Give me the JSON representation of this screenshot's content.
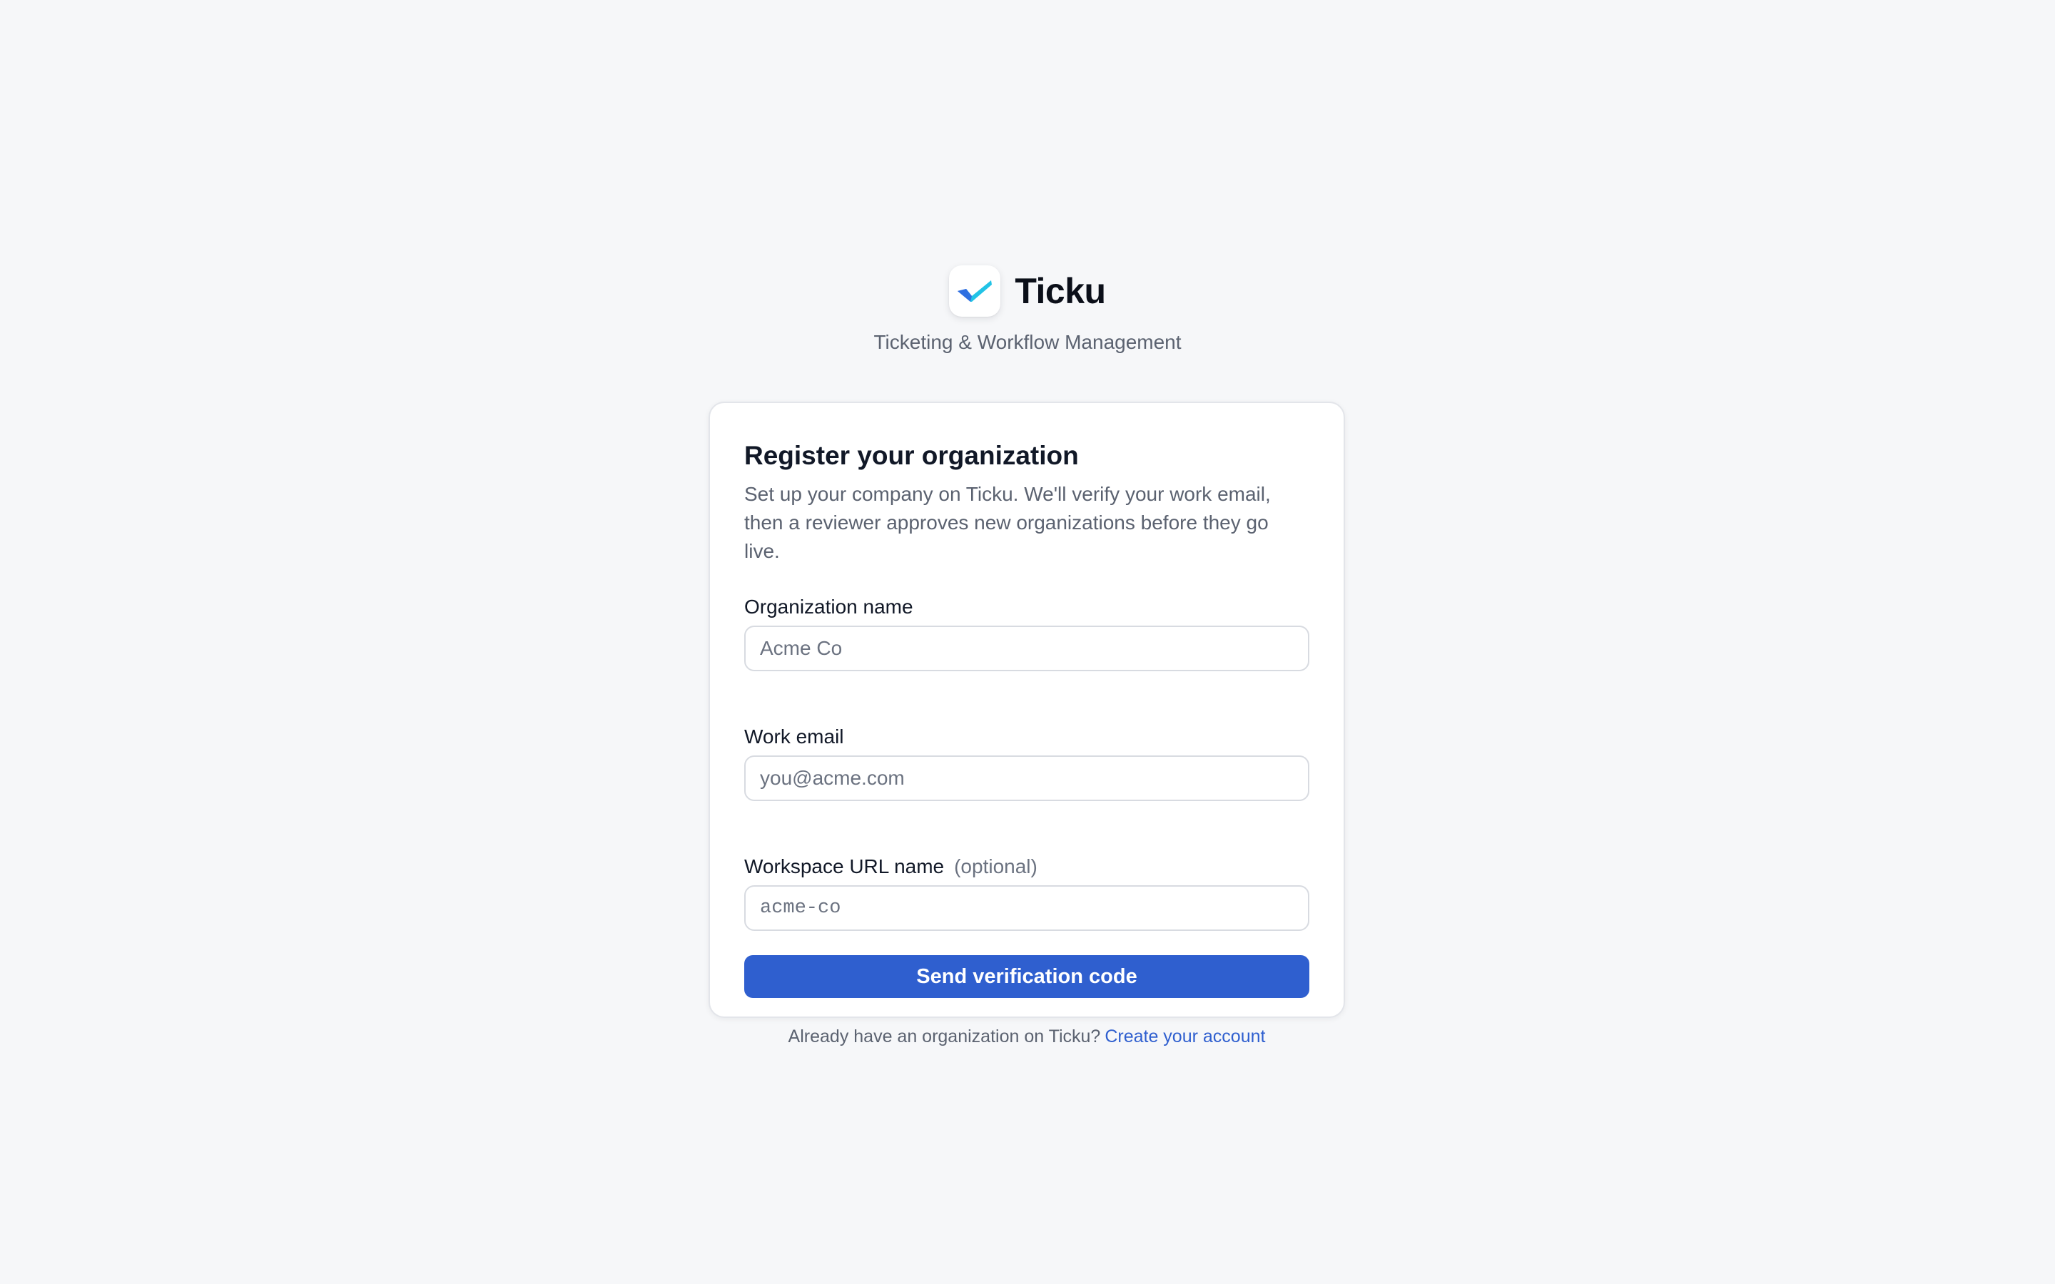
{
  "brand": {
    "name": "Ticku",
    "tagline": "Ticketing & Workflow Management",
    "logo_icon": "checkmark-logo-icon",
    "colors": {
      "logo_left": "#2f6fe0",
      "logo_right": "#22c3e6"
    }
  },
  "card": {
    "title": "Register your organization",
    "description": "Set up your company on Ticku. We'll verify your work email, then a reviewer approves new organizations before they go live.",
    "fields": [
      {
        "label": "Organization name",
        "placeholder": "Acme Co",
        "value": ""
      },
      {
        "label": "Work email",
        "placeholder": "you@acme.com",
        "value": ""
      },
      {
        "label": "Workspace URL name",
        "optional_label": "(optional)",
        "placeholder": "acme-co",
        "value": ""
      }
    ],
    "submit_label": "Send verification code",
    "footer_text": "Already have an organization on Ticku?",
    "footer_link": "Create your account"
  },
  "colors": {
    "background": "#f6f7f9",
    "accent": "#2f5fcf",
    "card_border": "#e3e5ea",
    "muted_text": "#5b6270"
  }
}
